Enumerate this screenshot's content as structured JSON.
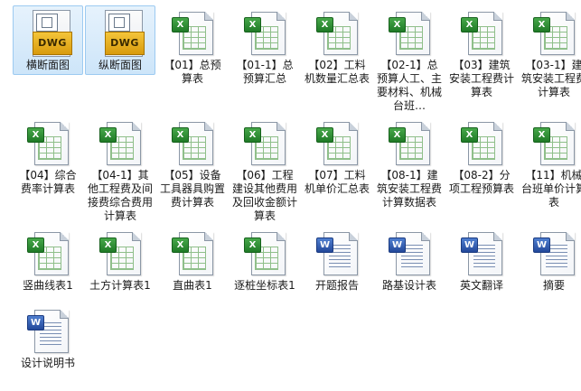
{
  "files": [
    {
      "label": "横断面图",
      "type": "dwg",
      "badge": "DWG",
      "selected": true
    },
    {
      "label": "纵断面图",
      "type": "dwg",
      "badge": "DWG",
      "selected": true
    },
    {
      "label": "【01】总预算表",
      "type": "xls",
      "badge": "X"
    },
    {
      "label": "【01-1】总预算汇总",
      "type": "xls",
      "badge": "X"
    },
    {
      "label": "【02】工料机数量汇总表",
      "type": "xls",
      "badge": "X"
    },
    {
      "label": "【02-1】总预算人工、主要材料、机械台班…",
      "type": "xls",
      "badge": "X"
    },
    {
      "label": "【03】建筑安装工程费计算表",
      "type": "xls",
      "badge": "X"
    },
    {
      "label": "【03-1】建筑安装工程费计算表",
      "type": "xls",
      "badge": "X"
    },
    {
      "label": "【04】综合费率计算表",
      "type": "xls",
      "badge": "X"
    },
    {
      "label": "【04-1】其他工程费及间接费综合费用计算表",
      "type": "xls",
      "badge": "X"
    },
    {
      "label": "【05】设备工具器具购置费计算表",
      "type": "xls",
      "badge": "X"
    },
    {
      "label": "【06】工程建设其他费用及回收金额计算表",
      "type": "xls",
      "badge": "X"
    },
    {
      "label": "【07】工料机单价汇总表",
      "type": "xls",
      "badge": "X"
    },
    {
      "label": "【08-1】建筑安装工程费计算数据表",
      "type": "xls",
      "badge": "X"
    },
    {
      "label": "【08-2】分项工程预算表",
      "type": "xls",
      "badge": "X"
    },
    {
      "label": "【11】机械台班单价计算表",
      "type": "xls",
      "badge": "X"
    },
    {
      "label": "竖曲线表1",
      "type": "xls",
      "badge": "X"
    },
    {
      "label": "土方计算表1",
      "type": "xls",
      "badge": "X"
    },
    {
      "label": "直曲表1",
      "type": "xls",
      "badge": "X"
    },
    {
      "label": "逐桩坐标表1",
      "type": "xls",
      "badge": "X"
    },
    {
      "label": "开题报告",
      "type": "doc",
      "badge": "W"
    },
    {
      "label": "路基设计表",
      "type": "doc",
      "badge": "W"
    },
    {
      "label": "英文翻译",
      "type": "doc",
      "badge": "W"
    },
    {
      "label": "摘要",
      "type": "doc",
      "badge": "W"
    },
    {
      "label": "设计说明书",
      "type": "doc",
      "badge": "W"
    }
  ]
}
